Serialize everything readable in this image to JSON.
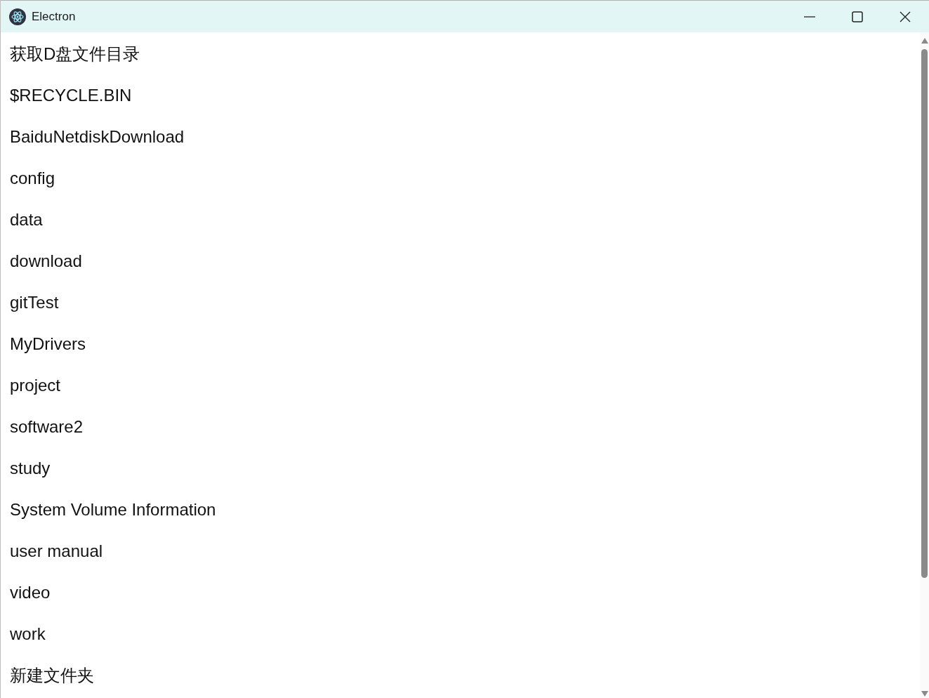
{
  "window": {
    "title": "Electron"
  },
  "heading": "获取D盘文件目录",
  "entries": [
    "$RECYCLE.BIN",
    "BaiduNetdiskDownload",
    "config",
    "data",
    "download",
    "gitTest",
    "MyDrivers",
    "project",
    "software2",
    "study",
    "System Volume Information",
    "user manual",
    "video",
    "work",
    "新建文件夹"
  ]
}
